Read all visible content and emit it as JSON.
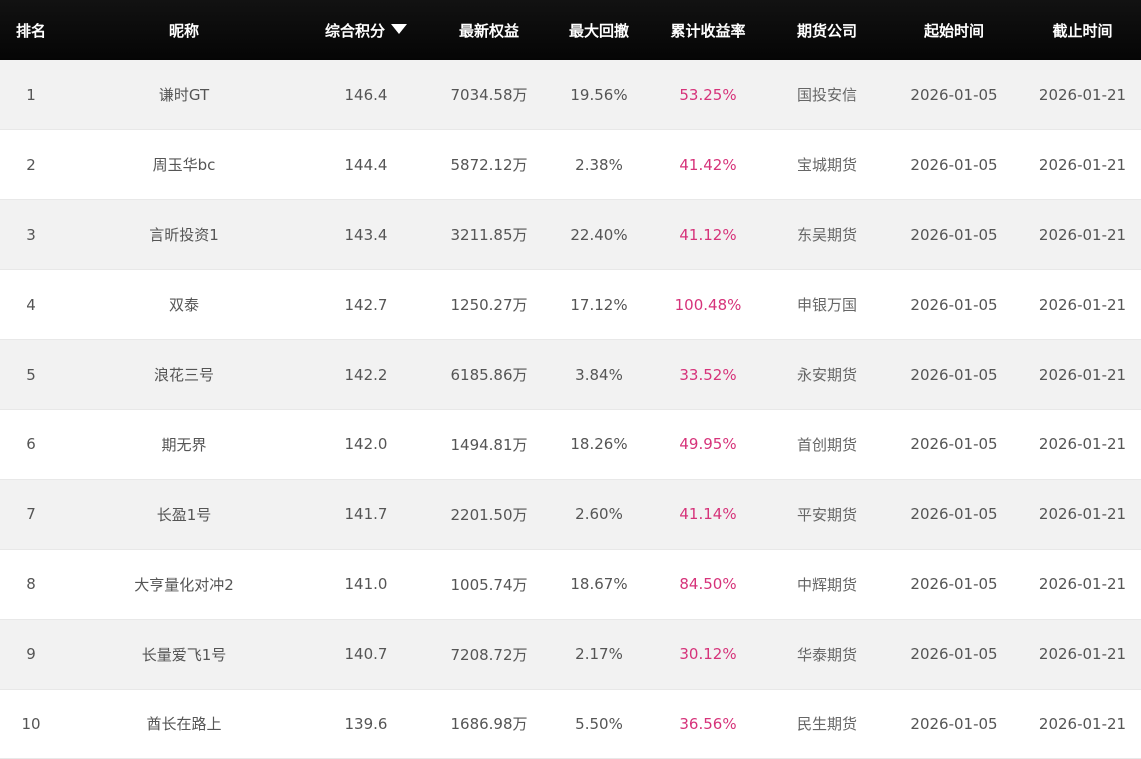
{
  "headers": {
    "rank": "排名",
    "nickname": "昵称",
    "score": "综合积分",
    "equity": "最新权益",
    "drawdown": "最大回撤",
    "return": "累计收益率",
    "broker": "期货公司",
    "start": "起始时间",
    "end": "截止时间"
  },
  "sort_icon": "sort-down-triangle",
  "colors": {
    "header_bg": "#0a0a0a",
    "row_odd": "#f2f2f2",
    "row_even": "#ffffff",
    "return_text": "#d6337a"
  },
  "rows": [
    {
      "rank": "1",
      "nickname": "谦时GT",
      "score": "146.4",
      "equity": "7034.58万",
      "drawdown": "19.56%",
      "return": "53.25%",
      "broker": "国投安信",
      "start": "2026-01-05",
      "end": "2026-01-21"
    },
    {
      "rank": "2",
      "nickname": "周玉华bc",
      "score": "144.4",
      "equity": "5872.12万",
      "drawdown": "2.38%",
      "return": "41.42%",
      "broker": "宝城期货",
      "start": "2026-01-05",
      "end": "2026-01-21"
    },
    {
      "rank": "3",
      "nickname": "言昕投资1",
      "score": "143.4",
      "equity": "3211.85万",
      "drawdown": "22.40%",
      "return": "41.12%",
      "broker": "东吴期货",
      "start": "2026-01-05",
      "end": "2026-01-21"
    },
    {
      "rank": "4",
      "nickname": "双泰",
      "score": "142.7",
      "equity": "1250.27万",
      "drawdown": "17.12%",
      "return": "100.48%",
      "broker": "申银万国",
      "start": "2026-01-05",
      "end": "2026-01-21"
    },
    {
      "rank": "5",
      "nickname": "浪花三号",
      "score": "142.2",
      "equity": "6185.86万",
      "drawdown": "3.84%",
      "return": "33.52%",
      "broker": "永安期货",
      "start": "2026-01-05",
      "end": "2026-01-21"
    },
    {
      "rank": "6",
      "nickname": "期无界",
      "score": "142.0",
      "equity": "1494.81万",
      "drawdown": "18.26%",
      "return": "49.95%",
      "broker": "首创期货",
      "start": "2026-01-05",
      "end": "2026-01-21"
    },
    {
      "rank": "7",
      "nickname": "长盈1号",
      "score": "141.7",
      "equity": "2201.50万",
      "drawdown": "2.60%",
      "return": "41.14%",
      "broker": "平安期货",
      "start": "2026-01-05",
      "end": "2026-01-21"
    },
    {
      "rank": "8",
      "nickname": "大亨量化对冲2",
      "score": "141.0",
      "equity": "1005.74万",
      "drawdown": "18.67%",
      "return": "84.50%",
      "broker": "中辉期货",
      "start": "2026-01-05",
      "end": "2026-01-21"
    },
    {
      "rank": "9",
      "nickname": "长量爱飞1号",
      "score": "140.7",
      "equity": "7208.72万",
      "drawdown": "2.17%",
      "return": "30.12%",
      "broker": "华泰期货",
      "start": "2026-01-05",
      "end": "2026-01-21"
    },
    {
      "rank": "10",
      "nickname": "酋长在路上",
      "score": "139.6",
      "equity": "1686.98万",
      "drawdown": "5.50%",
      "return": "36.56%",
      "broker": "民生期货",
      "start": "2026-01-05",
      "end": "2026-01-21"
    }
  ]
}
